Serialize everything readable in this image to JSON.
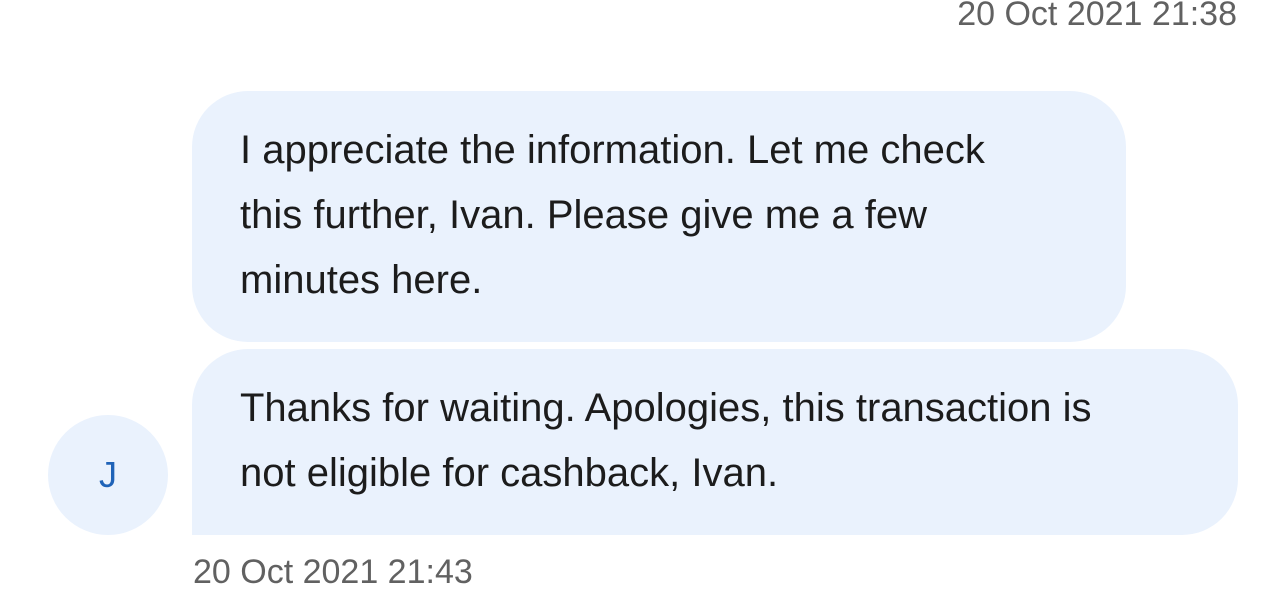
{
  "chat": {
    "top_timestamp": "20 Oct 2021 21:38",
    "messages": [
      {
        "lines": [
          "I appreciate the information. Let me check",
          "this further, Ivan. Please give me a few",
          "minutes here."
        ]
      },
      {
        "lines": [
          "Thanks for waiting. Apologies, this transaction is",
          "not eligible for cashback, Ivan."
        ]
      }
    ],
    "avatar_initial": "J",
    "bottom_timestamp": "20 Oct 2021 21:43"
  },
  "colors": {
    "bubble_background": "#eaf2fd",
    "avatar_text": "#1f63b8",
    "timestamp_text": "#616161",
    "message_text": "#1c1c1c"
  }
}
